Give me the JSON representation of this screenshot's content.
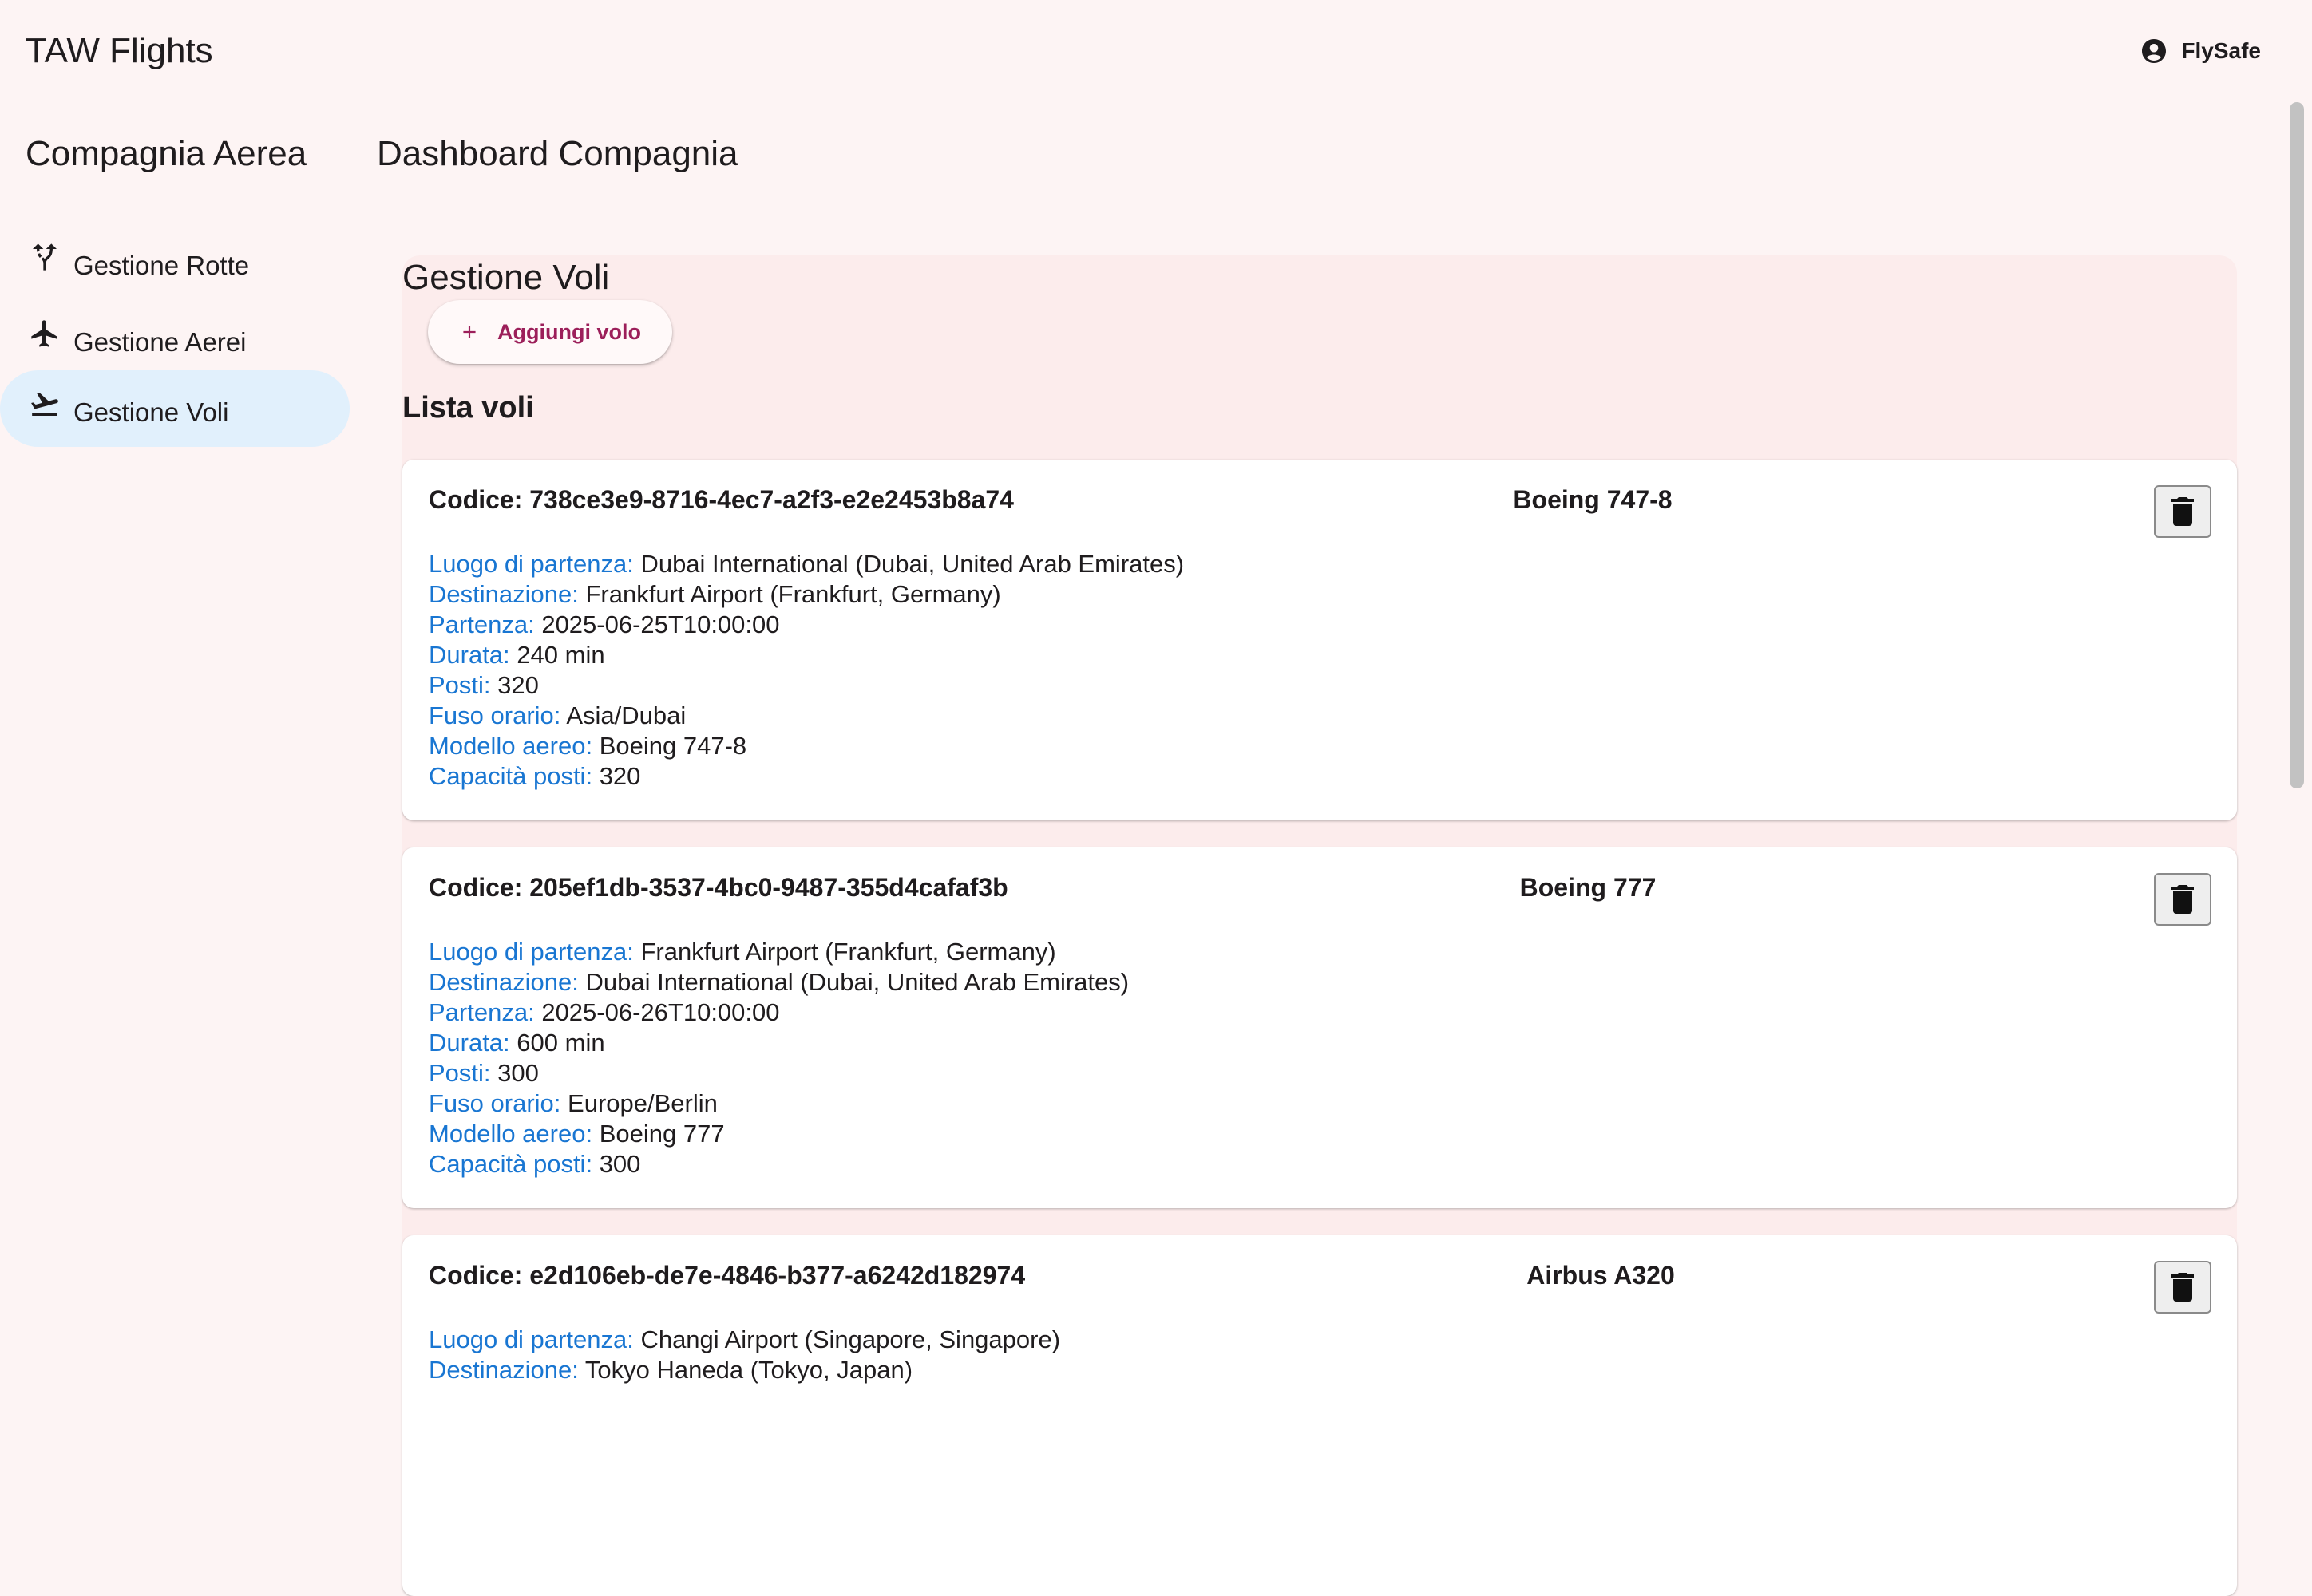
{
  "app": {
    "title": "TAW Flights"
  },
  "account": {
    "name": "FlySafe",
    "icon": "account-circle-icon"
  },
  "sidebar": {
    "title": "Compagnia Aerea",
    "items": [
      {
        "label": "Gestione Rotte",
        "icon": "route-icon",
        "active": false
      },
      {
        "label": "Gestione Aerei",
        "icon": "airplane-icon",
        "active": false
      },
      {
        "label": "Gestione Voli",
        "icon": "flight-takeoff-icon",
        "active": true
      }
    ]
  },
  "main": {
    "title": "Dashboard Compagnia",
    "section_title": "Gestione Voli",
    "add_button_label": "Aggiungi volo",
    "list_title": "Lista voli"
  },
  "labels": {
    "code": "Codice: ",
    "departure_place": "Luogo di partenza:",
    "destination": "Destinazione:",
    "departure": "Partenza:",
    "duration": "Durata:",
    "seats": "Posti:",
    "timezone": "Fuso orario:",
    "aircraft_model": "Modello aereo:",
    "seat_capacity": "Capacità posti:"
  },
  "flights": [
    {
      "code": "Codice: 738ce3e9-8716-4ec7-a2f3-e2e2453b8a74",
      "model_title": "Boeing 747-8",
      "departure_place": "Dubai International (Dubai, United Arab Emirates)",
      "destination": "Frankfurt Airport (Frankfurt, Germany)",
      "departure": "2025-06-25T10:00:00",
      "duration": "240 min",
      "seats": "320",
      "timezone": "Asia/Dubai",
      "aircraft_model": "Boeing 747-8",
      "seat_capacity": "320"
    },
    {
      "code": "Codice: 205ef1db-3537-4bc0-9487-355d4cafaf3b",
      "model_title": "Boeing 777",
      "departure_place": "Frankfurt Airport (Frankfurt, Germany)",
      "destination": "Dubai International (Dubai, United Arab Emirates)",
      "departure": "2025-06-26T10:00:00",
      "duration": "600 min",
      "seats": "300",
      "timezone": "Europe/Berlin",
      "aircraft_model": "Boeing 777",
      "seat_capacity": "300"
    },
    {
      "code": "Codice: e2d106eb-de7e-4846-b377-a6242d182974",
      "model_title": "Airbus A320",
      "departure_place": "Changi Airport (Singapore, Singapore)",
      "destination": "Tokyo Haneda (Tokyo, Japan)"
    }
  ],
  "colors": {
    "background": "#fdf4f4",
    "panel": "#fcecec",
    "label_blue": "#1976d2",
    "accent": "#9c1f5a",
    "active_nav": "#e1f0fc"
  }
}
